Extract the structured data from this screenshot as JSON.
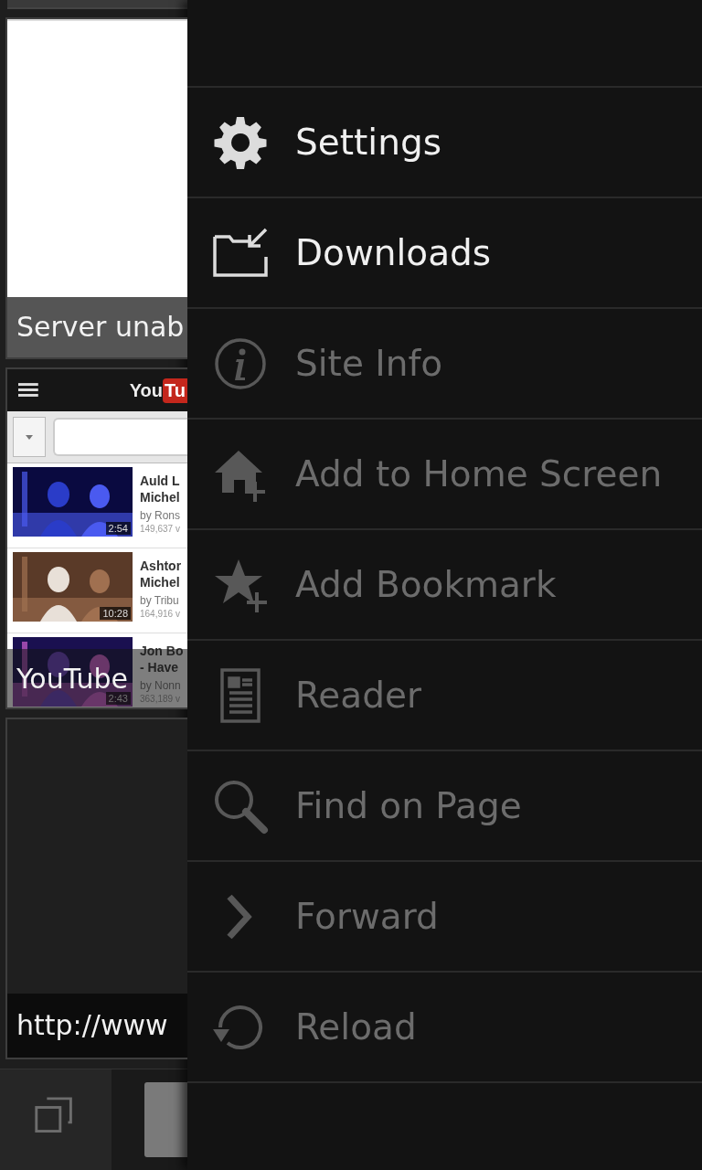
{
  "tabs": [
    {
      "kind": "blank",
      "title": "Server unab"
    },
    {
      "kind": "youtube",
      "title": "YouTube",
      "page": {
        "logo_left": "You",
        "logo_right": "Tu",
        "videos": [
          {
            "title_lines": [
              "Auld L",
              "Michel"
            ],
            "by": "by Rons",
            "views": "149,637 v",
            "duration": "2:54"
          },
          {
            "title_lines": [
              "Ashtor",
              "Michel"
            ],
            "by": "by Tribu",
            "views": "164,916 v",
            "duration": "10:28"
          },
          {
            "title_lines": [
              "Jon Bo",
              "- Have"
            ],
            "by": "by Nonn",
            "views": "363,189 v",
            "duration": "2:43"
          }
        ]
      }
    },
    {
      "kind": "empty",
      "title": "http://www"
    }
  ],
  "menu": [
    {
      "label": "Settings",
      "disabled": false
    },
    {
      "label": "Downloads",
      "disabled": false
    },
    {
      "label": "Site Info",
      "disabled": true
    },
    {
      "label": "Add to Home Screen",
      "disabled": true
    },
    {
      "label": "Add Bookmark",
      "disabled": true
    },
    {
      "label": "Reader",
      "disabled": true
    },
    {
      "label": "Find on Page",
      "disabled": true
    },
    {
      "label": "Forward",
      "disabled": true
    },
    {
      "label": "Reload",
      "disabled": true
    }
  ]
}
